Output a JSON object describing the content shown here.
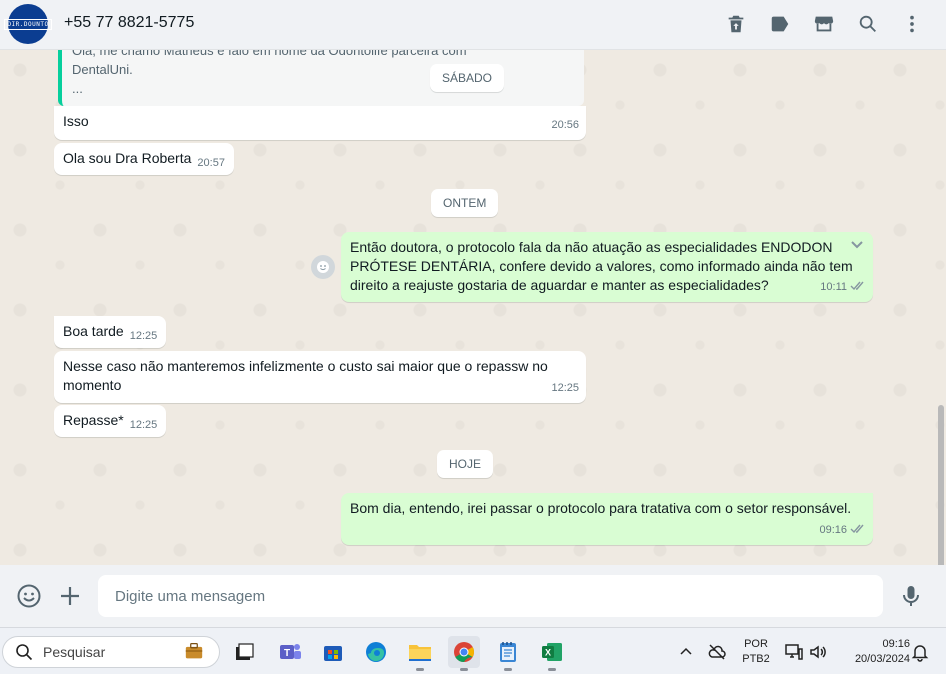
{
  "header": {
    "avatar_text": "DIR.DOUNTO",
    "contact": "+55 77 8821-5775",
    "icons": [
      "delete-icon",
      "label-icon",
      "store-icon",
      "search-icon",
      "menu-icon"
    ]
  },
  "quote": {
    "cut_line": "Olá, me chamo Matheus e falo em nome da Odontolife parceira com",
    "line2": "DentalUni.",
    "line3": "..."
  },
  "days": {
    "sabado": "SÁBADO",
    "ontem": "ONTEM",
    "hoje": "HOJE"
  },
  "messages": [
    {
      "text": "Isso",
      "time": "20:56"
    },
    {
      "text": "Ola sou Dra Roberta",
      "time": "20:57"
    },
    {
      "line1": "Então doutora, o protocolo fala da não atuação as especialidades ENDODON",
      "line2": "PRÓTESE DENTÁRIA, confere devido a valores, como informado ainda não tem",
      "line3": "direito a reajuste gostaria de aguardar e manter as especialidades?",
      "time": "10:11"
    },
    {
      "text": "Boa tarde",
      "time": "12:25"
    },
    {
      "line1": "Nesse caso não manteremos infelizmente o custo sai maior que o repassw no",
      "line2": "momento",
      "time": "12:25"
    },
    {
      "text": "Repasse*",
      "time": "12:25"
    },
    {
      "text": "Bom dia, entendo, irei passar o protocolo para tratativa com o setor responsável.",
      "time": "09:16"
    }
  ],
  "composer": {
    "placeholder": "Digite uma mensagem"
  },
  "taskbar": {
    "search_label": "Pesquisar",
    "lang1": "POR",
    "lang2": "PTB2",
    "clock_time": "09:16",
    "clock_date": "20/03/2024"
  }
}
